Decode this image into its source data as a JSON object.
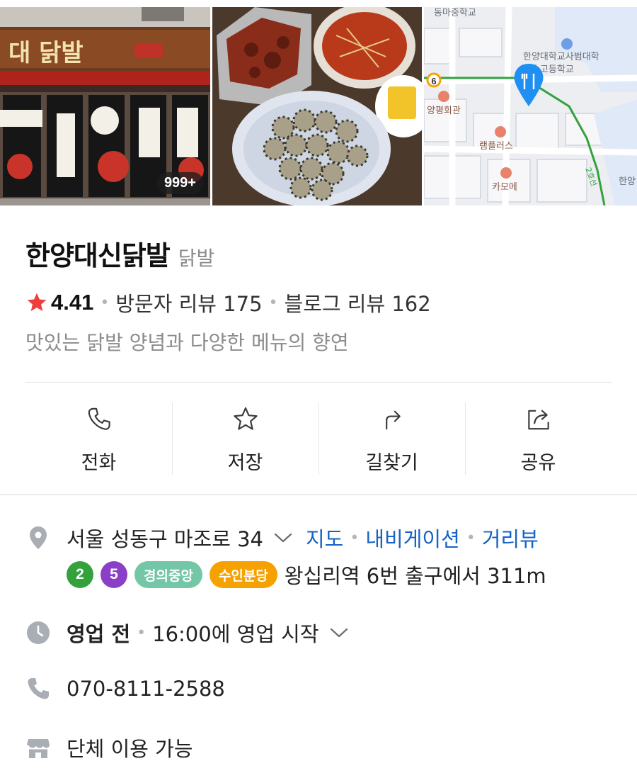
{
  "photos": {
    "count_badge": "999+",
    "store_sign": "대 닭발",
    "map_labels": {
      "school_top": "동마중학교",
      "school_right_1": "한양대학교사범대학",
      "school_right_2": "속고등학교",
      "restaurant_1": "양평회관",
      "restaurant_2": "램플러스",
      "restaurant_3": "카모메",
      "route_number": "6",
      "edge_label": "한양",
      "line_label": "2호선"
    }
  },
  "place": {
    "name": "한양대신닭발",
    "category": "닭발",
    "rating": "4.41",
    "visitor_reviews": "방문자 리뷰 175",
    "blog_reviews": "블로그 리뷰 162",
    "description": "맛있는 닭발 양념과 다양한 메뉴의 향연"
  },
  "actions": [
    {
      "label": "전화",
      "icon": "phone-icon"
    },
    {
      "label": "저장",
      "icon": "star-outline-icon"
    },
    {
      "label": "길찾기",
      "icon": "directions-icon"
    },
    {
      "label": "공유",
      "icon": "share-icon"
    }
  ],
  "info": {
    "address": "서울 성동구 마조로 34",
    "map_link": "지도",
    "navigation_link": "내비게이션",
    "streetview_link": "거리뷰",
    "subway": {
      "line2": "2",
      "line5": "5",
      "gyeongui": "경의중앙",
      "suin": "수인분당",
      "directions": "왕십리역 6번 출구에서 311m"
    },
    "hours_status": "영업 전",
    "hours_detail": "16:00에 영업 시작",
    "phone": "070-8111-2588",
    "group": "단체 이용 가능"
  },
  "colors": {
    "star": "#f03e3e",
    "link": "#1762c6",
    "line2": "#33a23d",
    "line5": "#8b3ec6",
    "gyeongui": "#73c7a6",
    "suin": "#f5a200",
    "map_pin": "#1f8ff2"
  }
}
